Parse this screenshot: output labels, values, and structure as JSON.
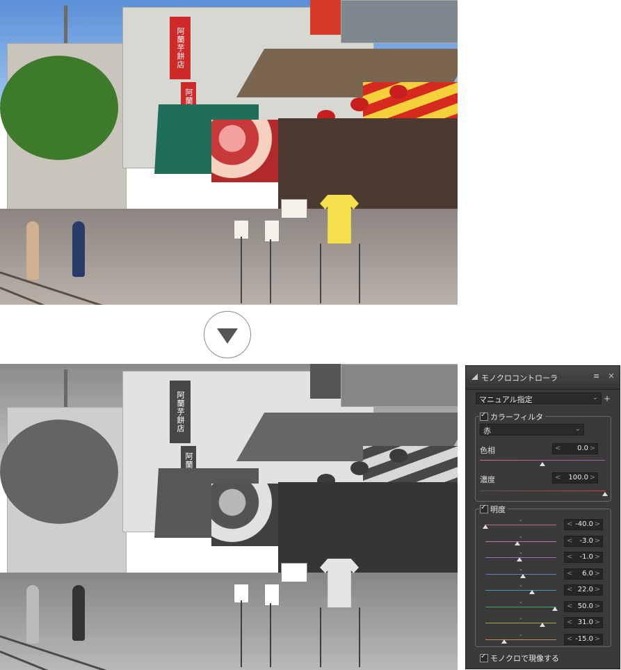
{
  "panel": {
    "title": "モノクロコントローラ",
    "menu_icon": "≡",
    "close_icon": "×",
    "mode": "マニュアル指定",
    "add_icon": "+",
    "color_filter": {
      "label": "カラーフィルタ",
      "checked": true,
      "filter": "赤",
      "hue": {
        "label": "色相",
        "value": "0.0",
        "level": 0.5
      },
      "density": {
        "label": "濃度",
        "value": "100.0",
        "level": 1.0
      }
    },
    "brightness": {
      "label": "明度",
      "checked": true,
      "sliders": [
        {
          "value": "-40.0",
          "level": 0.0,
          "color": "#c0707a"
        },
        {
          "value": "-3.0",
          "level": 0.45,
          "color": "#c070a8"
        },
        {
          "value": "-1.0",
          "level": 0.48,
          "color": "#9a70c0"
        },
        {
          "value": "6.0",
          "level": 0.53,
          "color": "#6080c8"
        },
        {
          "value": "22.0",
          "level": 0.66,
          "color": "#40a0b0"
        },
        {
          "value": "50.0",
          "level": 0.98,
          "color": "#40a870"
        },
        {
          "value": "31.0",
          "level": 0.8,
          "color": "#a8a840"
        },
        {
          "value": "-15.0",
          "level": 0.26,
          "color": "#c09060"
        }
      ]
    },
    "footer_label": "モノクロで現像する",
    "footer_checked": true
  },
  "photo": {
    "signs": [
      "阿蘭芋餅店",
      "阿蘭芋餅"
    ]
  }
}
